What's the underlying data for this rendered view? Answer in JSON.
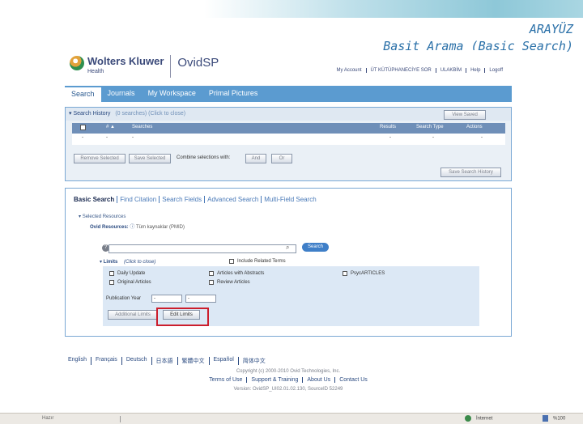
{
  "slide": {
    "title_line1": "ARAYÜZ",
    "title_line2": "Basit Arama (Basic Search)"
  },
  "brand": {
    "name": "Wolters Kluwer",
    "sub": "Health",
    "product": "OvidSP"
  },
  "top_links": [
    "My Account",
    "ÜT KÜTÜPHANECİYE SOR",
    "ULAKBİM",
    "Help",
    "Logoff"
  ],
  "main_tabs": [
    {
      "label": "Search",
      "active": true
    },
    {
      "label": "Journals",
      "active": false
    },
    {
      "label": "My Workspace",
      "active": false
    },
    {
      "label": "Primal Pictures",
      "active": false
    }
  ],
  "search_history": {
    "title": "Search History",
    "count_text": "(0 searches) (Click to close)",
    "view_saved": "View Saved",
    "columns": [
      "",
      "# ▲",
      "Searches",
      "Results",
      "Search Type",
      "Actions"
    ],
    "row": [
      "-",
      "-",
      "-",
      "-",
      "-",
      "-"
    ],
    "remove_selected": "Remove Selected",
    "save_selected": "Save Selected",
    "combine_label": "Combine selections with:",
    "and_btn": "And",
    "or_btn": "Or",
    "save_history": "Save Search History"
  },
  "basic_search": {
    "tabs": [
      "Basic Search",
      "Find Citation",
      "Search Fields",
      "Advanced Search",
      "Multi-Field Search"
    ],
    "selected_resources": "Selected Resources",
    "ovid_resources_label": "Ovid Resources:",
    "ovid_resources_value": "Tüm kaynaklar (PMID)",
    "search_placeholder": "",
    "search_button": "Search",
    "limits_label": "Limits",
    "limits_hint": "(Click to close)",
    "include_related": "Include Related Terms",
    "limit_items": [
      {
        "label": "Daily Update",
        "checked": false
      },
      {
        "label": "Articles with Abstracts",
        "checked": false
      },
      {
        "label": "PsycARTICLES",
        "checked": false
      },
      {
        "label": "Original Articles",
        "checked": false
      },
      {
        "label": "Review Articles",
        "checked": false
      }
    ],
    "publication_year_label": "Publication Year",
    "year_from": "-",
    "year_to": "-",
    "additional_limits": "Additional Limits",
    "edit_limits": "Edit Limits"
  },
  "footer": {
    "languages": [
      "English",
      "Français",
      "Deutsch",
      "日本語",
      "繁體中文",
      "Español",
      "简体中文"
    ],
    "copyright": "Copyright (c) 2000-2010 Ovid Technologies, Inc.",
    "links": [
      "Terms of Use",
      "Support & Training",
      "About Us",
      "Contact Us"
    ],
    "version": "Version: OvidSP_UI02.01.02.130, SourceID 52249"
  },
  "status_bar": {
    "left_text": "Hazır",
    "zone1": "İnternet",
    "zone2": "%100"
  },
  "colors": {
    "accent": "#5b9bd0",
    "highlight": "#cc1e2c",
    "title": "#2a70a8"
  }
}
